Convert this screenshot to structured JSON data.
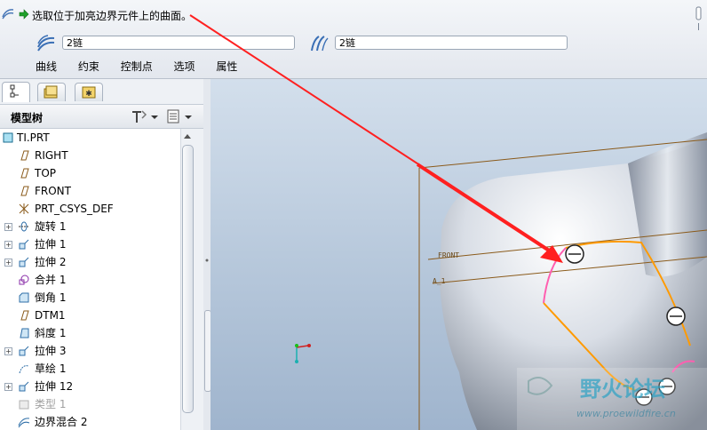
{
  "prompt": {
    "text": "选取位于加亮边界元件上的曲面。"
  },
  "collectors": {
    "first": {
      "value": "2链"
    },
    "second": {
      "value": "2链"
    }
  },
  "tabs": [
    "曲线",
    "约束",
    "控制点",
    "选项",
    "属性"
  ],
  "model_tree": {
    "title": "模型树",
    "items": [
      {
        "label": "TI.PRT",
        "icon": "part-icon"
      },
      {
        "label": "RIGHT",
        "icon": "datum-plane-icon"
      },
      {
        "label": "TOP",
        "icon": "datum-plane-icon"
      },
      {
        "label": "FRONT",
        "icon": "datum-plane-icon"
      },
      {
        "label": "PRT_CSYS_DEF",
        "icon": "csys-icon"
      },
      {
        "label": "旋转 1",
        "icon": "revolve-icon"
      },
      {
        "label": "拉伸 1",
        "icon": "extrude-icon"
      },
      {
        "label": "拉伸 2",
        "icon": "extrude-icon"
      },
      {
        "label": "合并 1",
        "icon": "merge-icon"
      },
      {
        "label": "倒角 1",
        "icon": "chamfer-icon"
      },
      {
        "label": "DTM1",
        "icon": "datum-plane-icon"
      },
      {
        "label": "斜度 1",
        "icon": "draft-icon"
      },
      {
        "label": "拉伸 3",
        "icon": "extrude-icon"
      },
      {
        "label": "草绘 1",
        "icon": "sketch-icon"
      },
      {
        "label": "拉伸 12",
        "icon": "extrude-icon"
      },
      {
        "label": "类型 1",
        "icon": "type-icon"
      },
      {
        "label": "边界混合 2",
        "icon": "boundary-blend-icon"
      }
    ]
  },
  "viewport": {
    "labels": {
      "front": "FRONT",
      "axis": "A_1"
    },
    "watermark": {
      "title": "野火论坛",
      "url": "www.proewildfire.cn"
    }
  },
  "colors": {
    "arrow": "#ff2020",
    "highlight_pink": "#ff5fb0",
    "highlight_orange": "#ff9a00"
  }
}
